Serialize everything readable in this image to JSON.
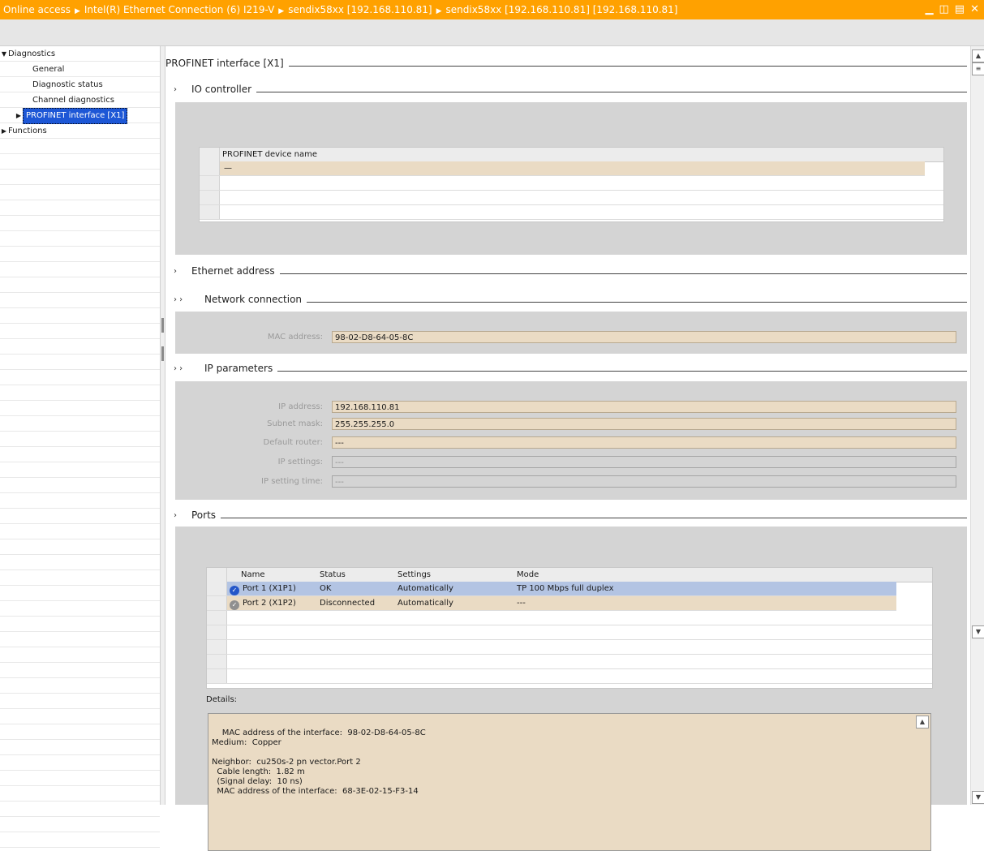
{
  "titlebar": {
    "crumbs": [
      "Online access",
      "Intel(R) Ethernet Connection (6) I219-V",
      "sendix58xx [192.168.110.81]",
      "sendix58xx [192.168.110.81] [192.168.110.81]"
    ],
    "controls": [
      "minimize-icon",
      "restore-icon",
      "tile-icon",
      "close-icon"
    ]
  },
  "tree": {
    "diagnostics": "Diagnostics",
    "general": "General",
    "diagnostic_status": "Diagnostic status",
    "channel_diagnostics": "Channel diagnostics",
    "profinet_interface": "PROFINET interface [X1]",
    "functions": "Functions"
  },
  "main": {
    "page_title": "PROFINET interface [X1]",
    "io_controller": {
      "title": "IO controller",
      "table_header": "PROFINET device name",
      "rows": [
        "—"
      ]
    },
    "ethernet_address": {
      "title": "Ethernet address",
      "network_connection": "Network connection",
      "mac_label": "MAC address:",
      "mac_value": "98-02-D8-64-05-8C",
      "ip_parameters": "IP parameters",
      "ip_address_label": "IP address:",
      "ip_address_value": "192.168.110.81",
      "subnet_label": "Subnet mask:",
      "subnet_value": "255.255.255.0",
      "router_label": "Default router:",
      "router_value": "---",
      "ip_settings_label": "IP settings:",
      "ip_settings_value": "---",
      "ip_time_label": "IP setting time:",
      "ip_time_value": "---"
    },
    "ports": {
      "title": "Ports",
      "columns": [
        "Name",
        "Status",
        "Settings",
        "Mode"
      ],
      "rows": [
        {
          "name": "Port 1 (X1P1)",
          "status": "OK",
          "settings": "Automatically",
          "mode": "TP 100 Mbps full duplex"
        },
        {
          "name": "Port 2 (X1P2)",
          "status": "Disconnected",
          "settings": "Automatically",
          "mode": "---"
        }
      ],
      "details_label": "Details:",
      "details_text": "MAC address of the interface:  98-02-D8-64-05-8C\nMedium:  Copper\n\nNeighbor:  cu250s-2 pn vector.Port 2\n  Cable length:  1.82 m\n  (Signal delay:  10 ns)\n  MAC address of the interface:  68-3E-02-15-F3-14"
    }
  },
  "colors": {
    "titlebar": "#ffa100",
    "selection": "#1d57d6",
    "field": "#eadbc4",
    "panel": "#d4d4d4",
    "row_selected": "#b3c4e3"
  }
}
